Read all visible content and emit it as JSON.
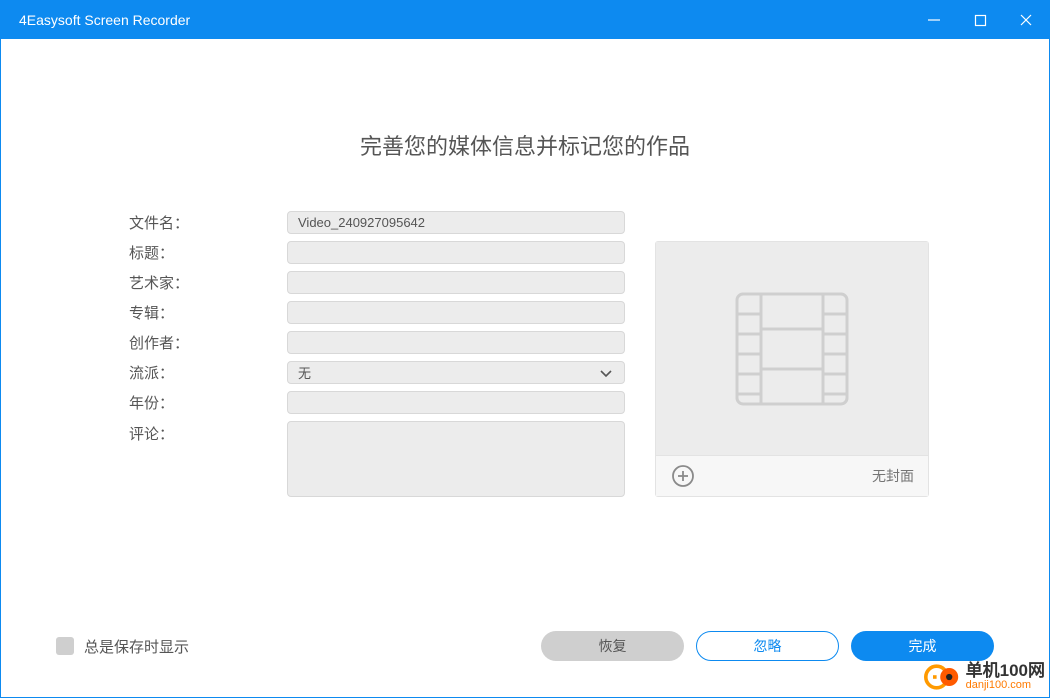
{
  "titlebar": {
    "title": "4Easysoft Screen Recorder"
  },
  "heading": "完善您的媒体信息并标记您的作品",
  "labels": {
    "filename": "文件名：",
    "title": "标题：",
    "artist": "艺术家：",
    "album": "专辑：",
    "creator": "创作者：",
    "genre": "流派：",
    "year": "年份：",
    "comment": "评论："
  },
  "values": {
    "filename": "Video_240927095642",
    "title": "",
    "artist": "",
    "album": "",
    "creator": "",
    "genre": "无",
    "year": "",
    "comment": ""
  },
  "cover": {
    "no_cover": "无封面"
  },
  "footer": {
    "always_show": "总是保存时显示",
    "restore": "恢复",
    "ignore": "忽略",
    "done": "完成"
  },
  "watermark": {
    "cn": "单机100网",
    "url": "danji100.com"
  }
}
